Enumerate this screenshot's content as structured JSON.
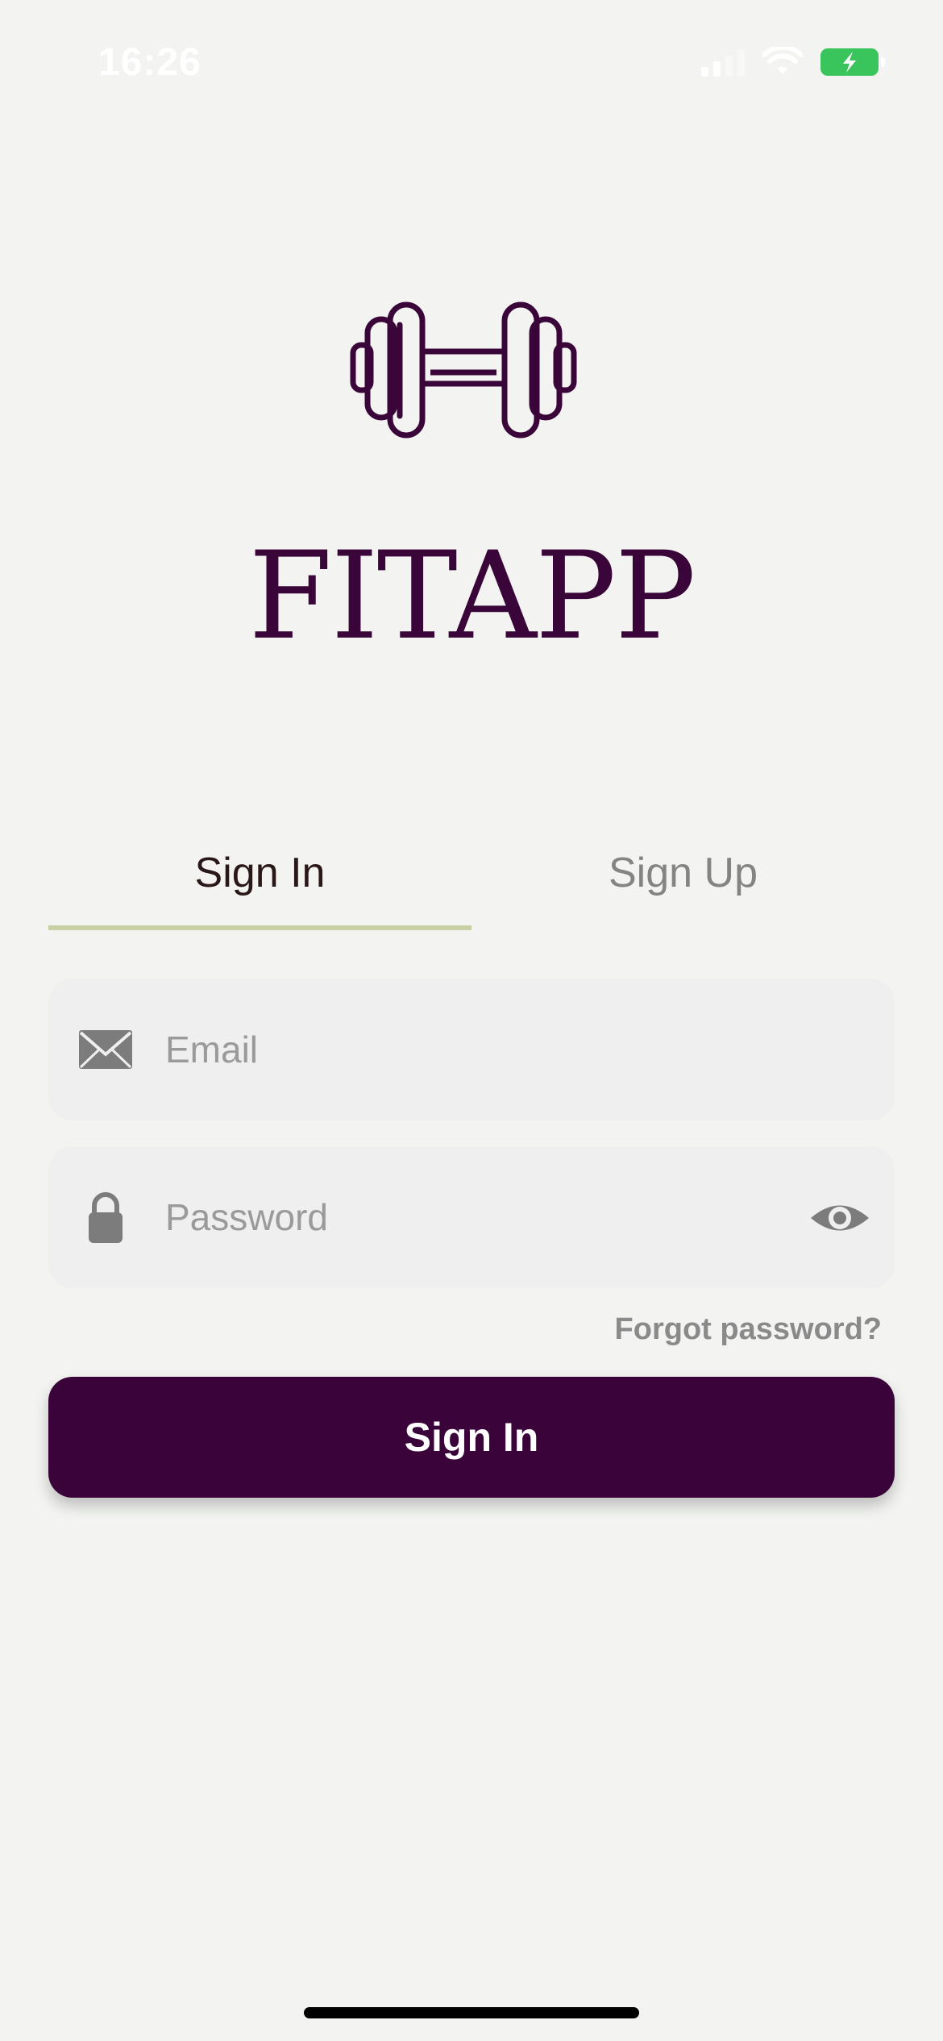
{
  "status_bar": {
    "time": "16:26",
    "icons": [
      "cellular-signal-icon",
      "wifi-icon",
      "battery-charging-icon"
    ],
    "battery_color": "#3ac45c"
  },
  "brand": {
    "logo_icon": "dumbbell-icon",
    "title": "FITAPP",
    "color": "#3a0639"
  },
  "auth_tabs": {
    "active": "Sign In",
    "tabs": [
      {
        "label": "Sign In"
      },
      {
        "label": "Sign Up"
      }
    ],
    "underline_color": "#c6d0a4"
  },
  "form": {
    "email": {
      "placeholder": "Email",
      "value": "",
      "icon": "envelope-icon"
    },
    "password": {
      "placeholder": "Password",
      "value": "",
      "icon": "lock-icon",
      "toggle_icon": "eye-icon"
    },
    "forgot_label": "Forgot password?",
    "submit_label": "Sign In",
    "submit_color": "#3a0339"
  }
}
